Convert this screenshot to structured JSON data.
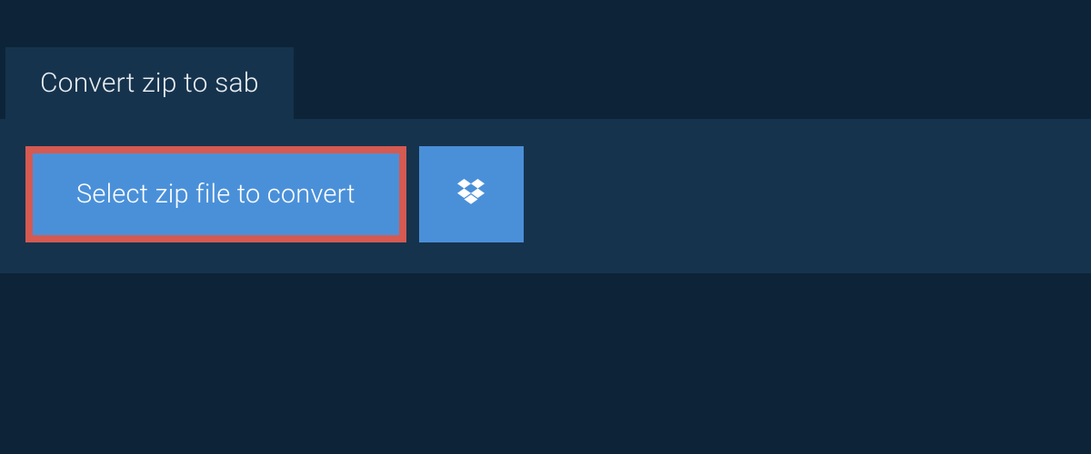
{
  "tab": {
    "title": "Convert zip to sab"
  },
  "main": {
    "select_button_label": "Select zip file to convert"
  },
  "colors": {
    "background": "#0d2438",
    "panel": "#16334d",
    "button": "#4a90d9",
    "highlight_border": "#d45a52",
    "text_light": "#e8eef3",
    "text_white": "#ffffff"
  }
}
